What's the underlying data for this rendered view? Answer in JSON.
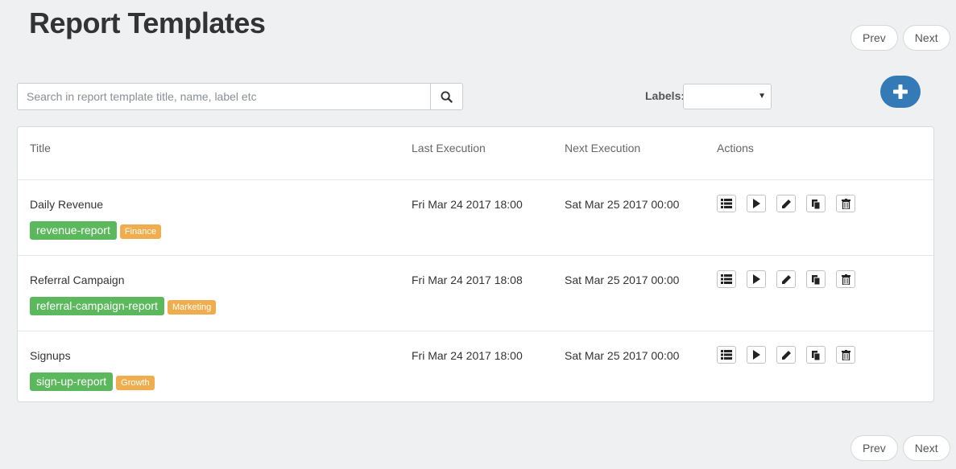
{
  "page": {
    "title": "Report Templates"
  },
  "pager": {
    "prev": "Prev",
    "next": "Next"
  },
  "search": {
    "placeholder": "Search in report template title, name, label etc"
  },
  "filters": {
    "labels_label": "Labels:",
    "labels_value": ""
  },
  "table": {
    "headers": {
      "title": "Title",
      "last": "Last Execution",
      "next": "Next Execution",
      "actions": "Actions"
    },
    "rows": [
      {
        "title": "Daily Revenue",
        "last": "Fri Mar 24 2017 18:00",
        "next": "Sat Mar 25 2017 00:00",
        "name": "revenue-report",
        "label": "Finance"
      },
      {
        "title": "Referral Campaign",
        "last": "Fri Mar 24 2017 18:08",
        "next": "Sat Mar 25 2017 00:00",
        "name": "referral-campaign-report",
        "label": "Marketing"
      },
      {
        "title": "Signups",
        "last": "Fri Mar 24 2017 18:00",
        "next": "Sat Mar 25 2017 00:00",
        "name": "sign-up-report",
        "label": "Growth"
      }
    ]
  },
  "icons": {
    "search": "search-icon",
    "add": "plus-icon",
    "list": "list-icon",
    "run": "play-icon",
    "edit": "pencil-icon",
    "copy": "copy-icon",
    "delete": "trash-icon"
  },
  "colors": {
    "primary": "#337ab7",
    "name_tag": "#5cb85c",
    "label_tag": "#f0ad4e",
    "background": "#eef0f1"
  }
}
